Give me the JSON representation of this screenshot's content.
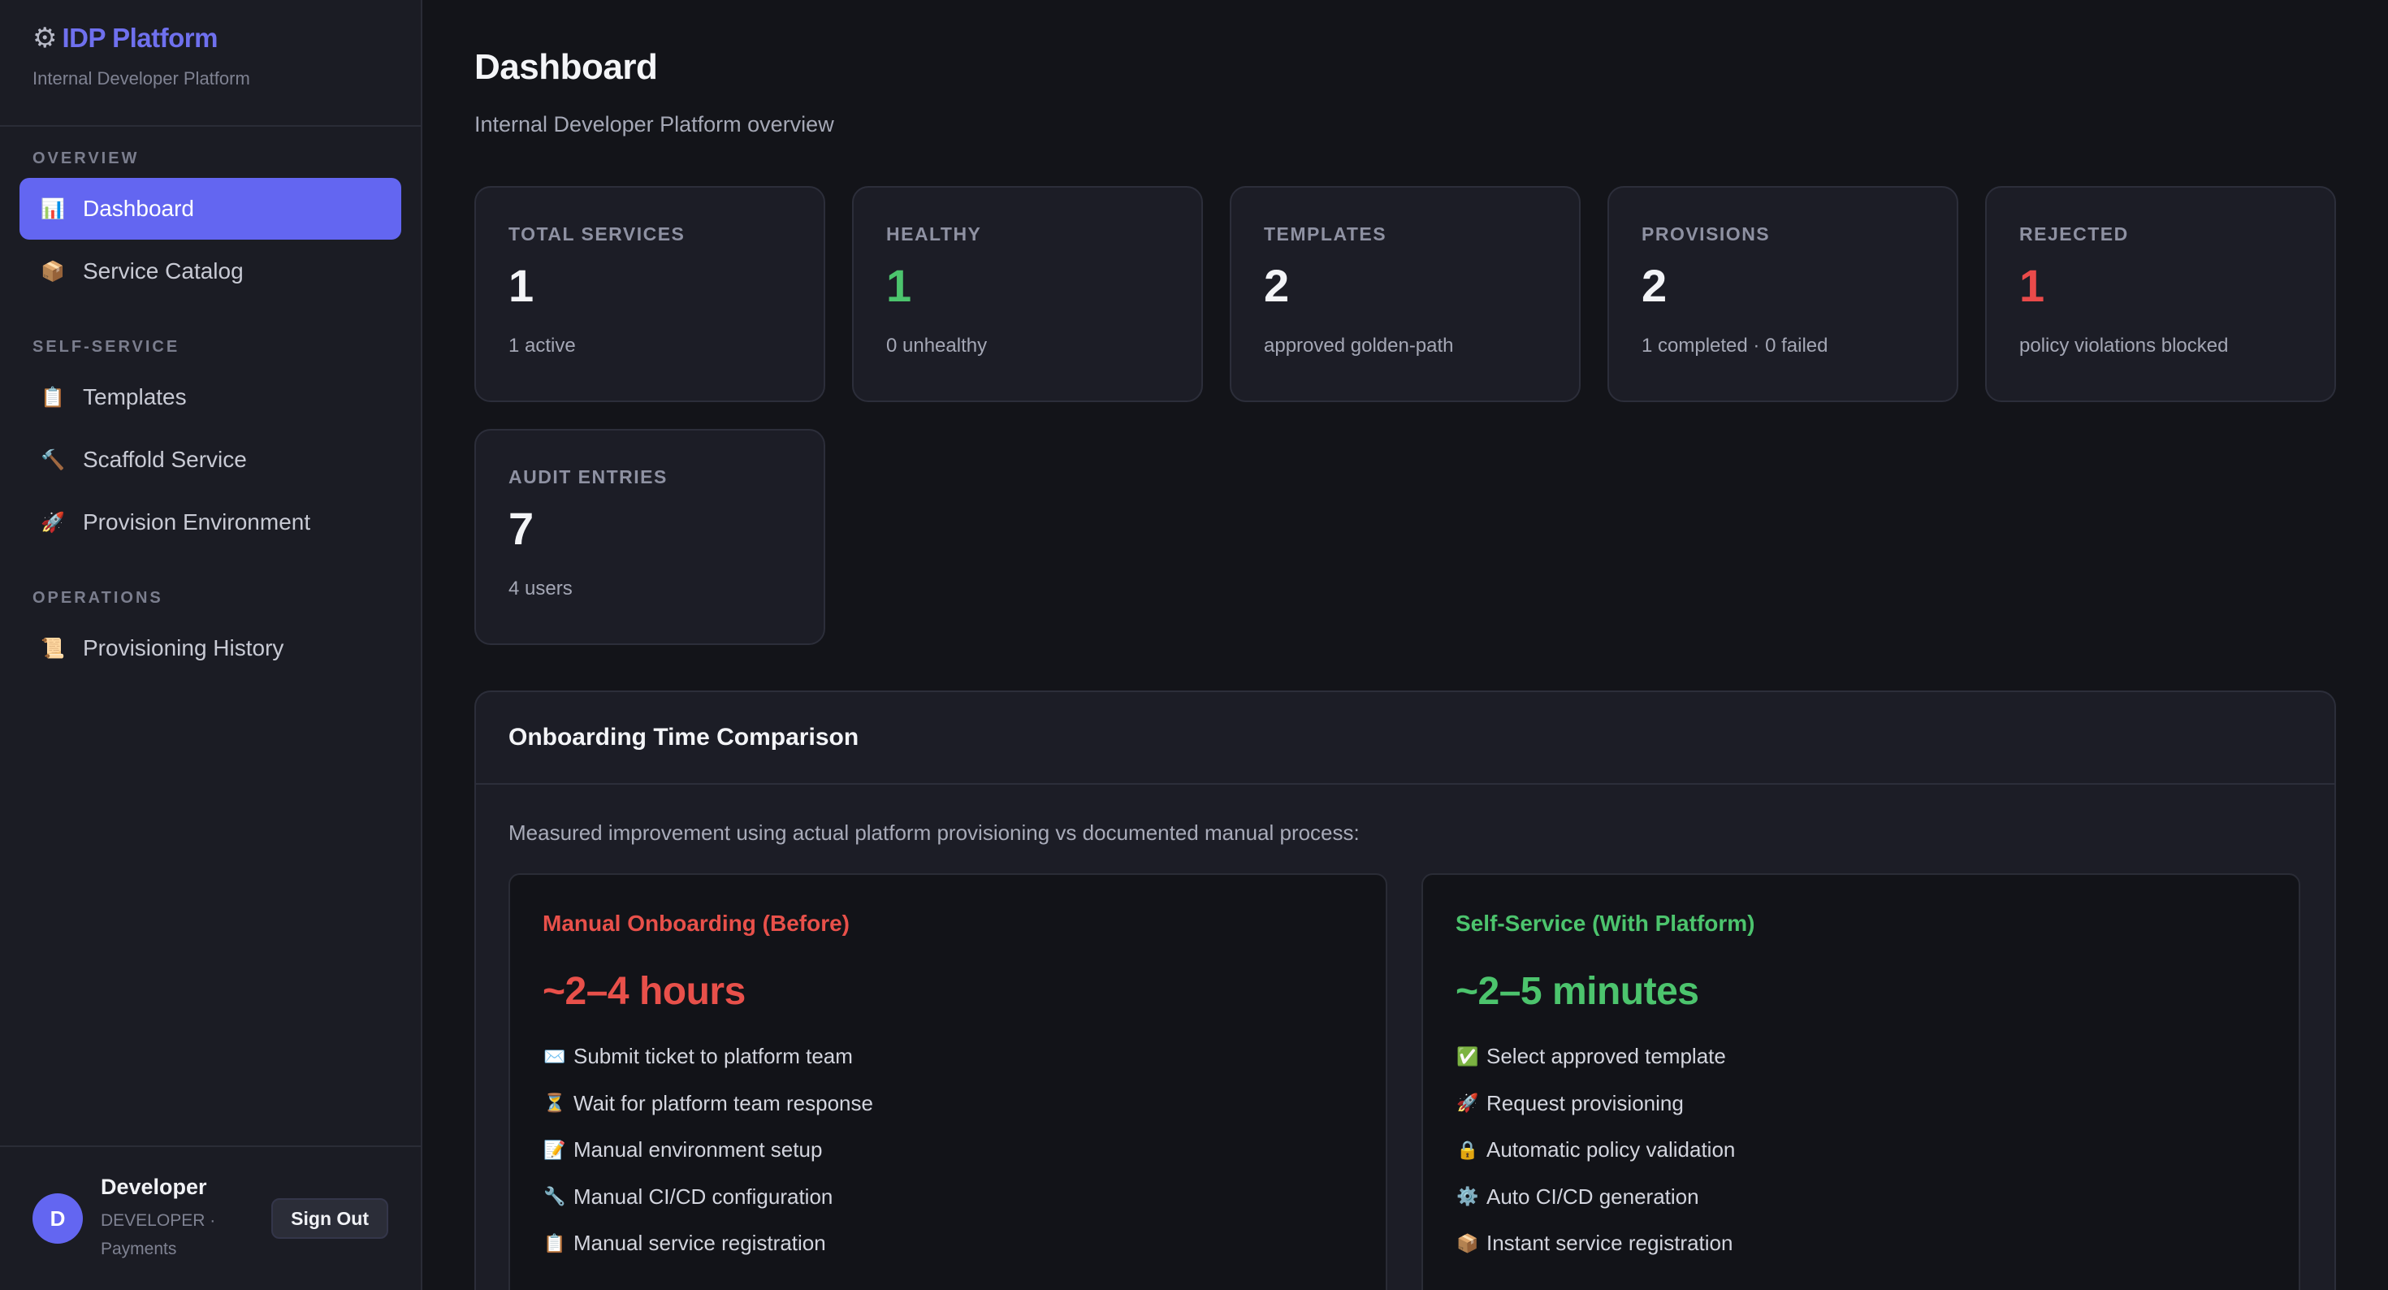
{
  "brand": {
    "icon": "gear-icon",
    "title": "IDP Platform",
    "subtitle": "Internal Developer Platform"
  },
  "nav": {
    "sections": [
      {
        "heading": "OVERVIEW",
        "items": [
          {
            "label": "Dashboard",
            "icon": "bar-chart-icon",
            "glyph": "📊",
            "active": true
          },
          {
            "label": "Service Catalog",
            "icon": "package-icon",
            "glyph": "📦",
            "active": false
          }
        ]
      },
      {
        "heading": "SELF-SERVICE",
        "items": [
          {
            "label": "Templates",
            "icon": "clipboard-icon",
            "glyph": "📋",
            "active": false
          },
          {
            "label": "Scaffold Service",
            "icon": "hammer-icon",
            "glyph": "🔨",
            "active": false
          },
          {
            "label": "Provision Environment",
            "icon": "rocket-icon",
            "glyph": "🚀",
            "active": false
          }
        ]
      },
      {
        "heading": "OPERATIONS",
        "items": [
          {
            "label": "Provisioning History",
            "icon": "scroll-icon",
            "glyph": "📜",
            "active": false
          }
        ]
      }
    ]
  },
  "user": {
    "initial": "D",
    "name": "Developer",
    "role": "DEVELOPER · Payments",
    "signout_label": "Sign Out"
  },
  "page": {
    "title": "Dashboard",
    "subtitle": "Internal Developer Platform overview"
  },
  "stats": [
    {
      "label": "TOTAL SERVICES",
      "value": "1",
      "note": "1 active",
      "tone": ""
    },
    {
      "label": "HEALTHY",
      "value": "1",
      "note": "0 unhealthy",
      "tone": "green"
    },
    {
      "label": "TEMPLATES",
      "value": "2",
      "note": "approved golden-path",
      "tone": ""
    },
    {
      "label": "PROVISIONS",
      "value": "2",
      "note": "1 completed · 0 failed",
      "tone": ""
    },
    {
      "label": "REJECTED",
      "value": "1",
      "note": "policy violations blocked",
      "tone": "red"
    },
    {
      "label": "AUDIT ENTRIES",
      "value": "7",
      "note": "4 users",
      "tone": ""
    }
  ],
  "comparison": {
    "title": "Onboarding Time Comparison",
    "description": "Measured improvement using actual platform provisioning vs documented manual process:",
    "manual": {
      "title": "Manual Onboarding (Before)",
      "duration": "~2–4 hours",
      "steps": [
        {
          "icon": "envelope-icon",
          "glyph": "✉️",
          "text": "Submit ticket to platform team"
        },
        {
          "icon": "hourglass-icon",
          "glyph": "⏳",
          "text": "Wait for platform team response"
        },
        {
          "icon": "memo-icon",
          "glyph": "📝",
          "text": "Manual environment setup"
        },
        {
          "icon": "wrench-icon",
          "glyph": "🔧",
          "text": "Manual CI/CD configuration"
        },
        {
          "icon": "clipboard-icon",
          "glyph": "📋",
          "text": "Manual service registration"
        }
      ]
    },
    "self_service": {
      "title": "Self-Service (With Platform)",
      "duration": "~2–5 minutes",
      "steps": [
        {
          "icon": "check-icon",
          "glyph": "✅",
          "text": "Select approved template"
        },
        {
          "icon": "rocket-icon",
          "glyph": "🚀",
          "text": "Request provisioning"
        },
        {
          "icon": "lock-icon",
          "glyph": "🔒",
          "text": "Automatic policy validation"
        },
        {
          "icon": "gear-icon",
          "glyph": "⚙️",
          "text": "Auto CI/CD generation"
        },
        {
          "icon": "package-icon",
          "glyph": "📦",
          "text": "Instant service registration"
        }
      ]
    }
  },
  "colors": {
    "accent": "#6366f1",
    "healthy": "#4cc46d",
    "danger": "#ea4a4a"
  }
}
